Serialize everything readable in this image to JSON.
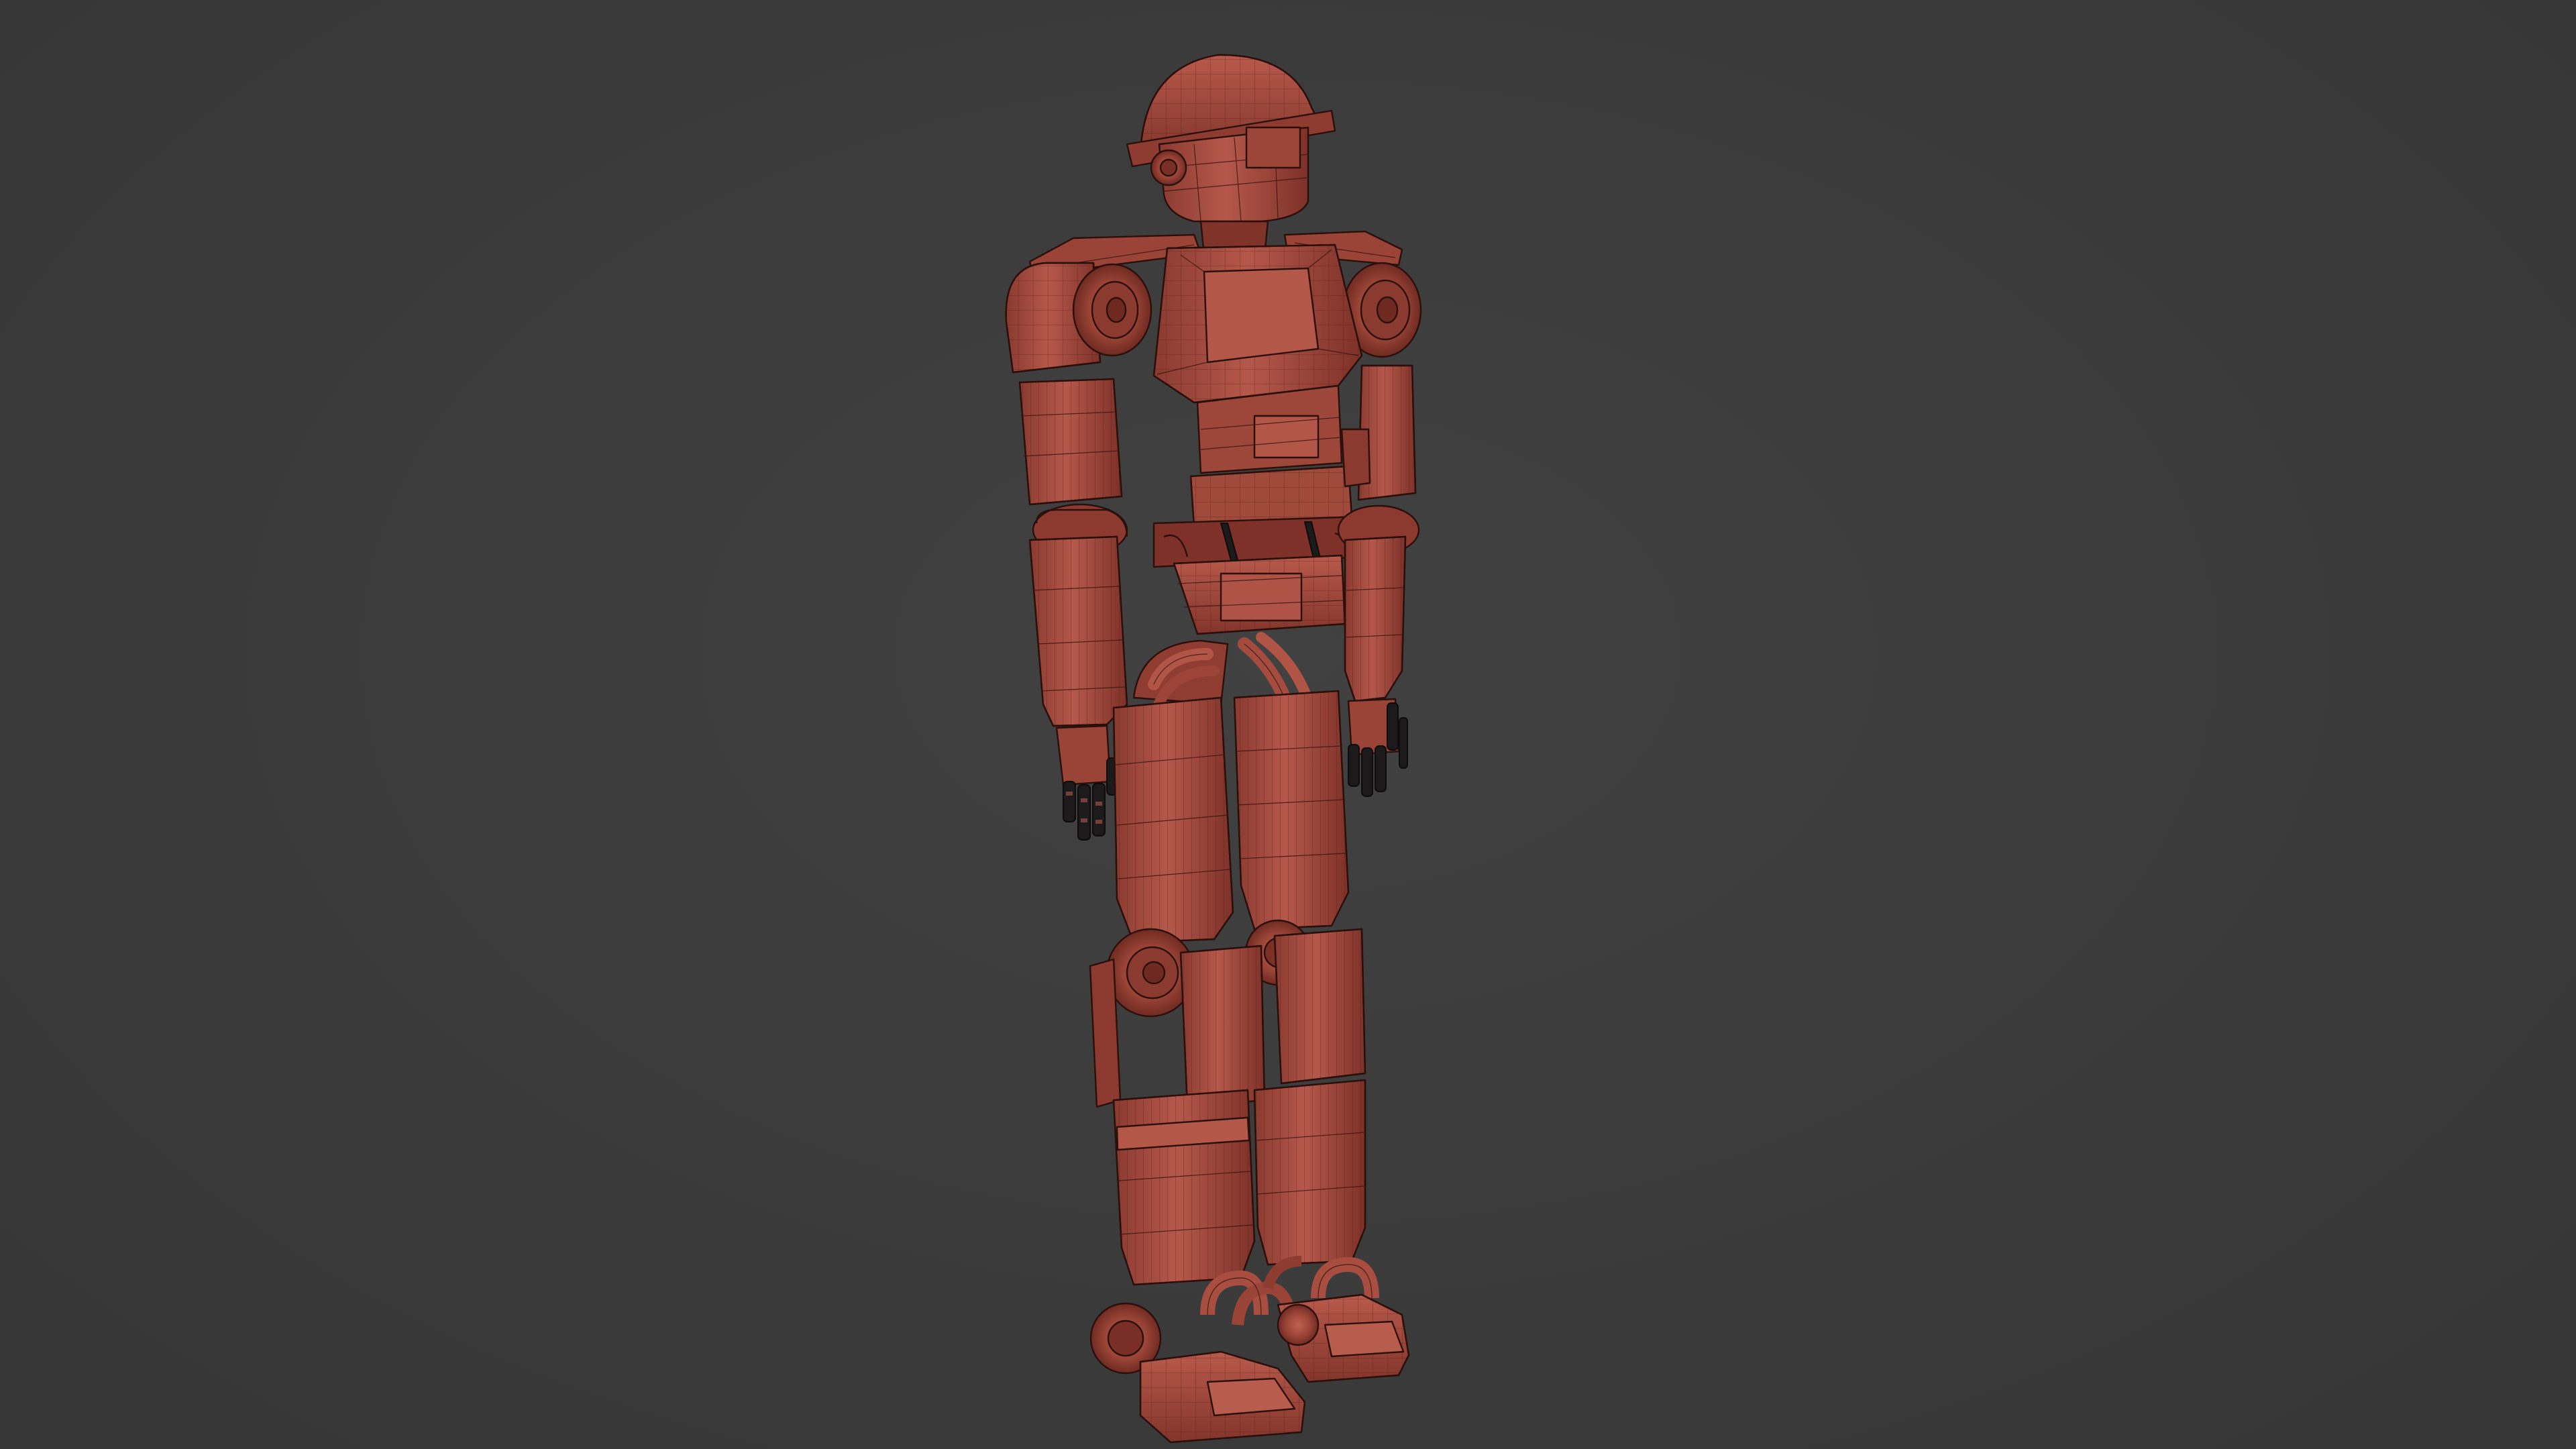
{
  "scene": {
    "background_color": "#3a3a3a",
    "model_color": "#a34a3e",
    "model_highlight_color": "#bb5d4f",
    "model_shadow_color": "#7a3027",
    "wire_color": "#3a150f",
    "joint_color": "#1c1a1a",
    "display_mode": "wireframe-on-shaded",
    "subject": "humanoid robot"
  }
}
